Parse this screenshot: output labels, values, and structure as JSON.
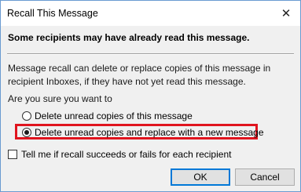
{
  "window": {
    "title": "Recall This Message",
    "close_icon": "close-icon"
  },
  "warning": "Some recipients may have already read this message.",
  "description": "Message recall can delete or replace copies of this message in recipient Inboxes, if they have not yet read this message.",
  "question": "Are you sure you want to",
  "options": [
    {
      "label": "Delete unread copies of this message",
      "selected": false
    },
    {
      "label": "Delete unread copies and replace with a new message",
      "selected": true
    }
  ],
  "checkbox": {
    "label": "Tell me if recall succeeds or fails for each recipient",
    "checked": false
  },
  "buttons": {
    "ok": "OK",
    "cancel": "Cancel"
  },
  "highlight_color": "#e0141e"
}
